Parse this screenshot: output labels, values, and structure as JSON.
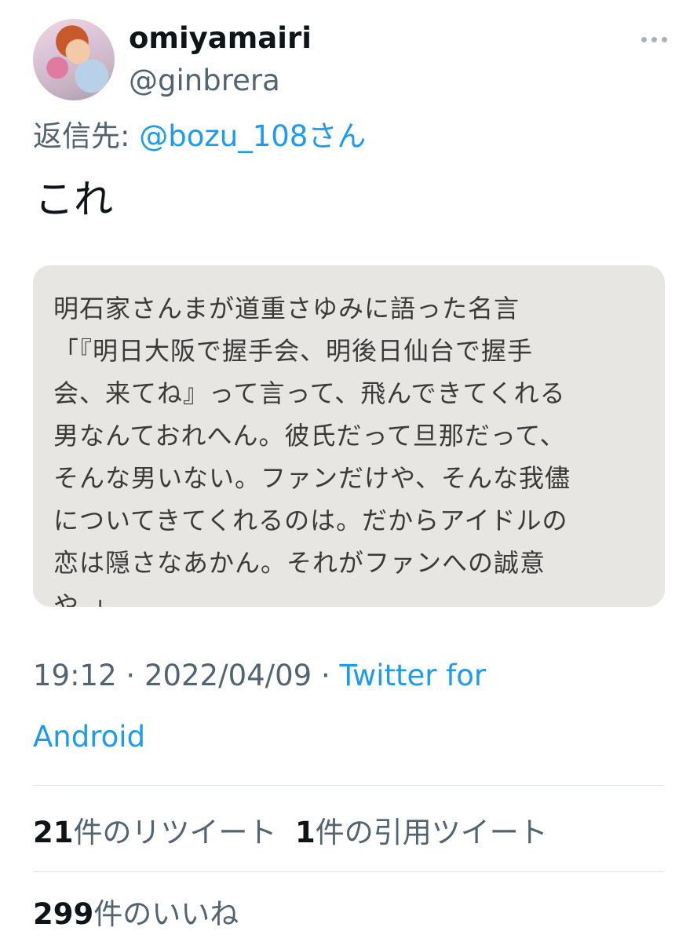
{
  "author": {
    "display_name": "omiyamairi",
    "handle": "@ginbrera"
  },
  "reply_to": {
    "prefix": "返信先: ",
    "mention": "@bozu_108さん"
  },
  "tweet": {
    "text": "これ"
  },
  "quote_image": {
    "lines": [
      "明石家さんまが道重さゆみに語った名言",
      "「『明日大阪で握手会、明後日仙台で握手",
      "会、来てね』って言って、飛んできてくれる",
      "男なんておれへん。彼氏だって旦那だって、",
      "そんな男いない。ファンだけや、そんな我儘",
      "についてきてくれるのは。だからアイドルの",
      "恋は隠さなあかん。それがファンへの誠意",
      "や。」"
    ]
  },
  "meta": {
    "time": "19:12",
    "separator": " · ",
    "date": "2022/04/09",
    "source_line1": "Twitter for",
    "source_line2": "Android"
  },
  "stats": {
    "retweets_count": "21",
    "retweets_label": "件のリツイート",
    "quotes_count": "1",
    "quotes_label": "件の引用ツイート",
    "likes_count": "299",
    "likes_label": "件のいいね"
  },
  "icons": {
    "more": "more-horizontal-icon"
  }
}
